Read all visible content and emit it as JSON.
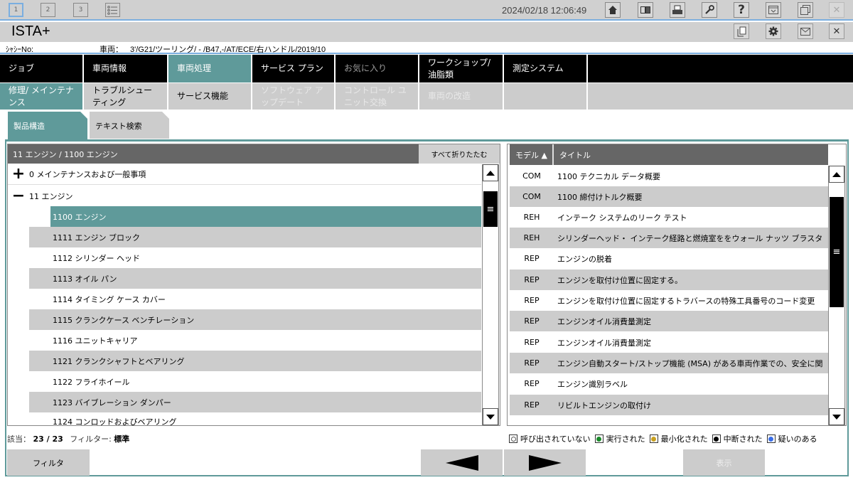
{
  "topbar": {
    "workspaces": [
      "1",
      "2",
      "3"
    ],
    "datetime": "2024/02/18 12:06:49",
    "icons": [
      "home-icon",
      "dual-view-icon",
      "print-icon",
      "wrench-icon",
      "help-icon",
      "screenshot-icon",
      "restore-window-icon",
      "close-icon"
    ],
    "help_glyph": "?",
    "close_glyph": "✕"
  },
  "app": {
    "title": "ISTA+",
    "icons": [
      "document-copy-icon",
      "settings-icon",
      "message-icon",
      "close-icon"
    ],
    "close_glyph": "✕"
  },
  "vehicle": {
    "vin_label": "ｼｬｼｰNo:",
    "vehicle_label": "車両：",
    "vehicle_value": "3'/G21/ツーリング/ - /B47,-/AT/ECE/右ハンドル/2019/10"
  },
  "main_nav": [
    {
      "label": "ジョブ",
      "state": "normal"
    },
    {
      "label": "車両情報",
      "state": "normal"
    },
    {
      "label": "車両処理",
      "state": "active"
    },
    {
      "label": "サービス プラン",
      "state": "normal"
    },
    {
      "label": "お気に入り",
      "state": "dim"
    },
    {
      "label": "ワークショップ/ 油脂類",
      "state": "normal"
    },
    {
      "label": "測定システム",
      "state": "normal"
    },
    {
      "label": "",
      "state": "normal"
    }
  ],
  "sub_nav": [
    {
      "label": "修理/ メインテナンス",
      "state": "active"
    },
    {
      "label": "トラブルシューティング",
      "state": "normal"
    },
    {
      "label": "サービス機能",
      "state": "normal"
    },
    {
      "label": "ソフトウェア アップデート",
      "state": "disabled"
    },
    {
      "label": "コントロール ユニット交換",
      "state": "disabled"
    },
    {
      "label": "車両の改造",
      "state": "disabled"
    },
    {
      "label": "",
      "state": "normal"
    },
    {
      "label": "",
      "state": "normal"
    }
  ],
  "tabs": [
    {
      "label": "製品構造",
      "active": true
    },
    {
      "label": "テキスト検索",
      "active": false
    }
  ],
  "tree": {
    "breadcrumb": "11 エンジン / 1100 エンジン",
    "collapse_all": "すべて折りたたむ",
    "groups": [
      {
        "toggle": "+",
        "label": "0 メインテナンスおよび一般事項"
      },
      {
        "toggle": "−",
        "label": "11 エンジン"
      }
    ],
    "items": [
      {
        "label": "1100 エンジン",
        "selected": true
      },
      {
        "label": "1111 エンジン ブロック"
      },
      {
        "label": "1112 シリンダー ヘッド"
      },
      {
        "label": "1113 オイル パン"
      },
      {
        "label": "1114 タイミング ケース カバー"
      },
      {
        "label": "1115 クランクケース ベンチレーション"
      },
      {
        "label": "1116 ユニットキャリア"
      },
      {
        "label": "1121 クランクシャフトとベアリング"
      },
      {
        "label": "1122 フライホイール"
      },
      {
        "label": "1123 バイブレーション ダンパー"
      },
      {
        "label": "1124 コンロッドおよびベアリング"
      }
    ]
  },
  "documents": {
    "col_model": "モデル ▲",
    "col_title": "タイトル",
    "rows": [
      {
        "model": "COM",
        "title": "1100 テクニカル データ概要"
      },
      {
        "model": "COM",
        "title": "1100 締付けトルク概要"
      },
      {
        "model": "REH",
        "title": "インテーク システムのリーク テスト"
      },
      {
        "model": "REH",
        "title": "シリンダーヘッド・ インテーク経路と燃焼室ををウォール ナッツ ブラスタ"
      },
      {
        "model": "REP",
        "title": "エンジンの脱着"
      },
      {
        "model": "REP",
        "title": "エンジンを取付け位置に固定する。"
      },
      {
        "model": "REP",
        "title": "エンジンを取付け位置に固定するトラバースの特殊工具番号のコード変更"
      },
      {
        "model": "REP",
        "title": "エンジンオイル消費量測定"
      },
      {
        "model": "REP",
        "title": "エンジンオイル消費量測定"
      },
      {
        "model": "REP",
        "title": "エンジン自動スタート/ストップ機能 (MSA) がある車両作業での、安全に関"
      },
      {
        "model": "REP",
        "title": "エンジン識別ラベル"
      },
      {
        "model": "REP",
        "title": "リビルトエンジンの取付け"
      }
    ]
  },
  "footer": {
    "match_label": "該当：",
    "match_value": "23 / 23",
    "filter_label": "フィルター:",
    "filter_value": "標準",
    "filter_button": "フィルタ",
    "show_button": "表示",
    "legend": [
      {
        "label": "呼び出されていない",
        "color": "#ffffff"
      },
      {
        "label": "実行された",
        "color": "#1a8a2a"
      },
      {
        "label": "最小化された",
        "color": "#c8a020"
      },
      {
        "label": "中断された",
        "color": "#000000"
      },
      {
        "label": "疑いのある",
        "color": "#3a6ee8"
      }
    ]
  },
  "scroll": {
    "tree_position": 0.05,
    "documents_position": 0.12
  },
  "colors": {
    "accent": "#5f9a9a",
    "nav_bg": "#000000",
    "header_bg": "#666666",
    "row_alt": "#cccccc",
    "chrome": "#d0d0d0",
    "highlight": "#7aaee0"
  }
}
